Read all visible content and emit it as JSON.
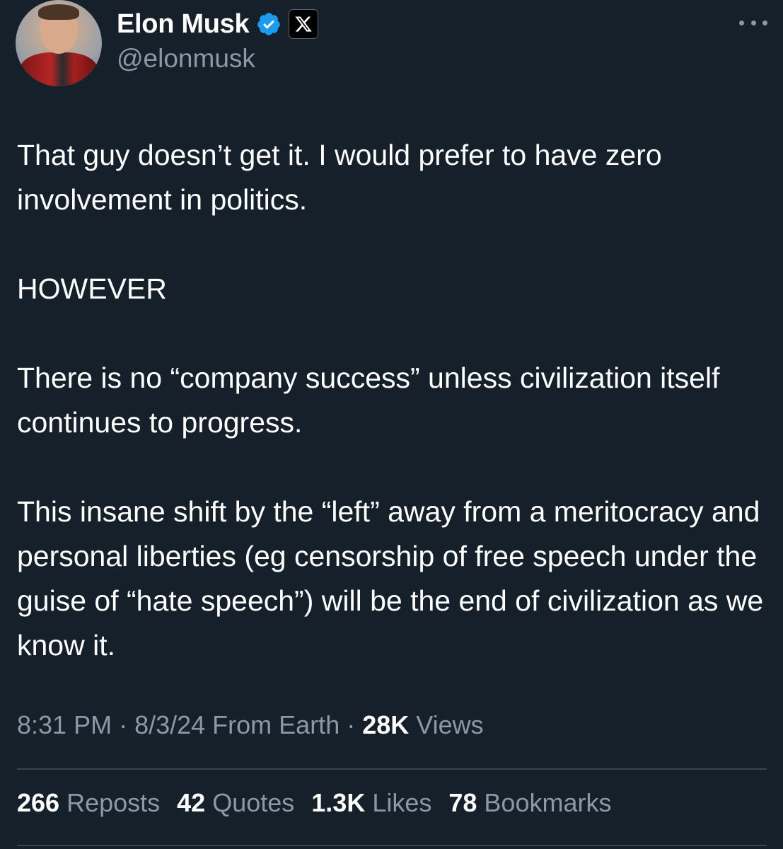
{
  "author": {
    "display_name": "Elon Musk",
    "handle": "@elonmusk",
    "verified": true,
    "affiliation_badge": "X"
  },
  "tweet": {
    "paragraphs": [
      "That guy doesn’t get it. I would prefer to have zero involvement in politics.",
      "HOWEVER",
      "There is no “company success” unless civilization itself continues to progress.",
      "This insane shift by the “left” away from a meritocracy and personal liberties (eg censorship of free speech under the guise of “hate speech”) will be the end of civilization as we know it."
    ]
  },
  "meta": {
    "time": "8:31 PM",
    "sep1": " · ",
    "date": "8/3/24",
    "source": " From Earth",
    "sep2": " · ",
    "views_count": "28K",
    "views_label": " Views"
  },
  "stats": {
    "reposts_count": "266",
    "reposts_label": " Reposts",
    "quotes_count": "42",
    "quotes_label": " Quotes",
    "likes_count": "1.3K",
    "likes_label": " Likes",
    "bookmarks_count": "78",
    "bookmarks_label": " Bookmarks"
  },
  "colors": {
    "background": "#15202b",
    "primary_text": "#ffffff",
    "secondary_text": "#8b98a5",
    "verified_blue": "#1d9bf0",
    "divider": "#38444d"
  },
  "icons": {
    "verified": "verified-badge-icon",
    "affiliation": "x-logo-icon",
    "more": "more-options-icon"
  }
}
